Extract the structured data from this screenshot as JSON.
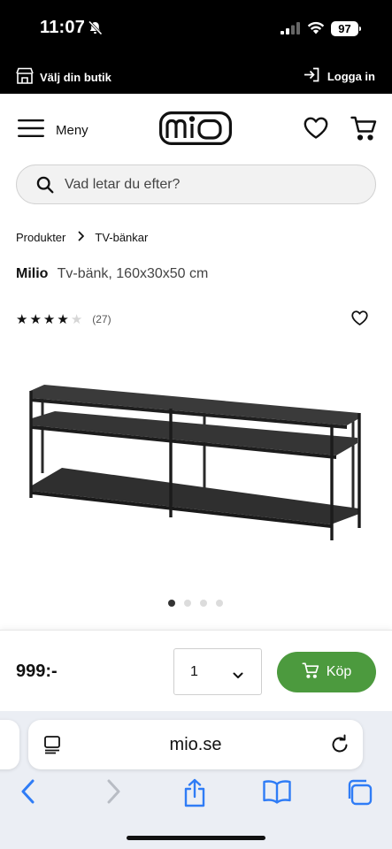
{
  "status_bar": {
    "time": "11:07",
    "battery": "97"
  },
  "store_bar": {
    "store_label": "Välj din butik",
    "login_label": "Logga in"
  },
  "header": {
    "menu_label": "Meny",
    "logo_text": "mio"
  },
  "search": {
    "placeholder": "Vad letar du efter?"
  },
  "breadcrumb": {
    "items": [
      "Produkter",
      "TV-bänkar"
    ]
  },
  "product": {
    "brand": "Milio",
    "name": "Tv-bänk, 160x30x50 cm",
    "rating": 4,
    "rating_max": 5,
    "review_count": "(27)",
    "image_count": 4,
    "active_image": 1
  },
  "buy_bar": {
    "price": "999:-",
    "quantity": "1",
    "buy_label": "Köp"
  },
  "browser": {
    "url": "mio.se"
  },
  "colors": {
    "buy_button": "#4c9a3e",
    "top_bar": "#000000",
    "browser_chrome": "#ebeef4",
    "browser_blue": "#2f7cf6"
  },
  "icons": [
    "bell-muted-icon",
    "signal-icon",
    "wifi-icon",
    "store-icon",
    "login-icon",
    "hamburger-icon",
    "heart-icon",
    "cart-icon",
    "search-icon",
    "chevron-right-icon",
    "chevron-down-icon",
    "tabs-icon",
    "reload-icon",
    "back-icon",
    "forward-icon",
    "share-icon",
    "bookmarks-icon",
    "tabs-overview-icon"
  ]
}
